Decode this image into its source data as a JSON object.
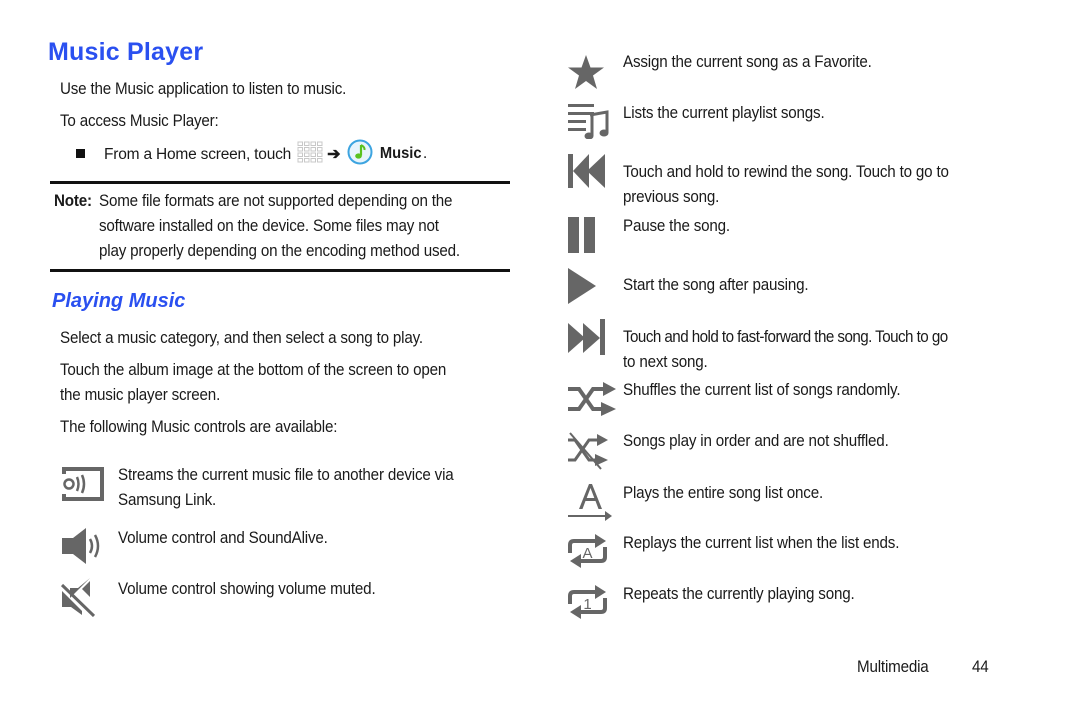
{
  "page": {
    "title": "Music Player",
    "intro": "Use the Music application to listen to music.",
    "access_label": "To access Music Player:",
    "step": {
      "prefix": "From a Home screen, touch",
      "arrow": "➔",
      "app_label": "Music",
      "suffix": "."
    },
    "note": {
      "label": "Note:",
      "lines": [
        "Some file formats are not supported depending on the",
        "software installed on the device. Some files may not",
        "play properly depending on the encoding method used."
      ]
    },
    "section_title": "Playing Music",
    "paragraphs": [
      "Select a music category, and then select a song to play.",
      "Touch the album image at the bottom of the screen to open",
      "the music player screen.",
      "The following Music controls are available:"
    ],
    "left_controls": [
      {
        "icon": "samsung-link-icon",
        "lines": [
          "Streams the current music file to another device via",
          "Samsung Link."
        ]
      },
      {
        "icon": "volume-icon",
        "lines": [
          "Volume control and SoundAlive."
        ]
      },
      {
        "icon": "volume-muted-icon",
        "lines": [
          "Volume control showing volume muted."
        ]
      }
    ],
    "right_controls": [
      {
        "icon": "favorite-star-icon",
        "lines": [
          "Assign the current song as a Favorite."
        ]
      },
      {
        "icon": "playlist-icon",
        "lines": [
          "Lists the current playlist songs."
        ]
      },
      {
        "icon": "rewind-icon",
        "lines": [
          "Touch and hold to rewind the song. Touch to go to",
          "previous song."
        ]
      },
      {
        "icon": "pause-icon",
        "lines": [
          "Pause the song."
        ]
      },
      {
        "icon": "play-icon",
        "lines": [
          "Start the song after pausing."
        ]
      },
      {
        "icon": "fast-forward-icon",
        "lines": [
          "Touch and hold to fast-forward the song. Touch to go",
          "to next song."
        ]
      },
      {
        "icon": "shuffle-on-icon",
        "lines": [
          "Shuffles the current list of songs randomly."
        ]
      },
      {
        "icon": "shuffle-off-icon",
        "lines": [
          "Songs play in order and are not shuffled."
        ]
      },
      {
        "icon": "play-once-icon",
        "lines": [
          "Plays the entire song list once."
        ]
      },
      {
        "icon": "repeat-all-icon",
        "lines": [
          "Replays the current list when the list ends."
        ]
      },
      {
        "icon": "repeat-one-icon",
        "lines": [
          "Repeats the currently playing song."
        ]
      }
    ],
    "footer": {
      "section": "Multimedia",
      "page_number": "44"
    },
    "colors": {
      "heading_blue": "#2a50f0",
      "icon_gray": "#666666",
      "text": "#1a1a1a"
    }
  }
}
